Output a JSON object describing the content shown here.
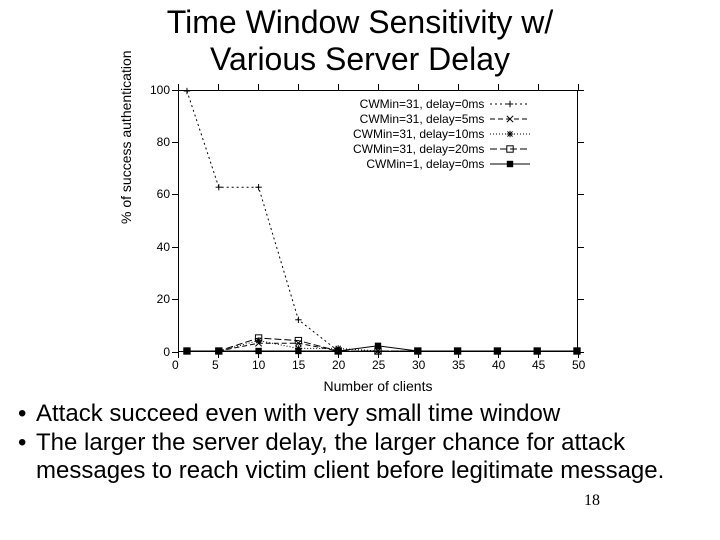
{
  "title_line1": "Time Window Sensitivity w/",
  "title_line2": "Various Server Delay",
  "bullets": {
    "b1": "Attack succeed even with very small time window",
    "b2": "The larger the server delay, the larger chance for attack messages to reach victim client before legitimate message."
  },
  "page_number": "18",
  "chart_data": {
    "type": "line",
    "xlabel": "Number of clients",
    "ylabel": "% of success authentication",
    "xlim": [
      0,
      50
    ],
    "ylim": [
      0,
      100
    ],
    "xticks": [
      0,
      5,
      10,
      15,
      20,
      25,
      30,
      35,
      40,
      45,
      50
    ],
    "yticks": [
      0,
      20,
      40,
      60,
      80,
      100
    ],
    "x": [
      1,
      5,
      10,
      15,
      20,
      25,
      30,
      35,
      40,
      45,
      50
    ],
    "series": [
      {
        "name": "CWMin=31, delay=0ms",
        "marker": "+",
        "dash": "2,3",
        "values": [
          100,
          63,
          63,
          12,
          0,
          0,
          0,
          0,
          0,
          0,
          0
        ]
      },
      {
        "name": "CWMin=31, delay=5ms",
        "marker": "x",
        "dash": "5,3",
        "values": [
          0,
          0,
          3,
          3,
          0,
          0,
          0,
          0,
          0,
          0,
          0
        ]
      },
      {
        "name": "CWMin=31, delay=10ms",
        "marker": "*",
        "dash": "1,2",
        "values": [
          0,
          0,
          4,
          1,
          1,
          0,
          0,
          0,
          0,
          0,
          0
        ]
      },
      {
        "name": "CWMin=31, delay=20ms",
        "marker": "□",
        "dash": "7,3",
        "values": [
          0,
          0,
          5,
          4,
          0,
          0,
          0,
          0,
          0,
          0,
          0
        ]
      },
      {
        "name": "CWMin=1, delay=0ms",
        "marker": "■",
        "dash": "0",
        "values": [
          0,
          0,
          0,
          0,
          0,
          2,
          0,
          0,
          0,
          0,
          0
        ]
      }
    ],
    "legend_position": "top-right"
  }
}
